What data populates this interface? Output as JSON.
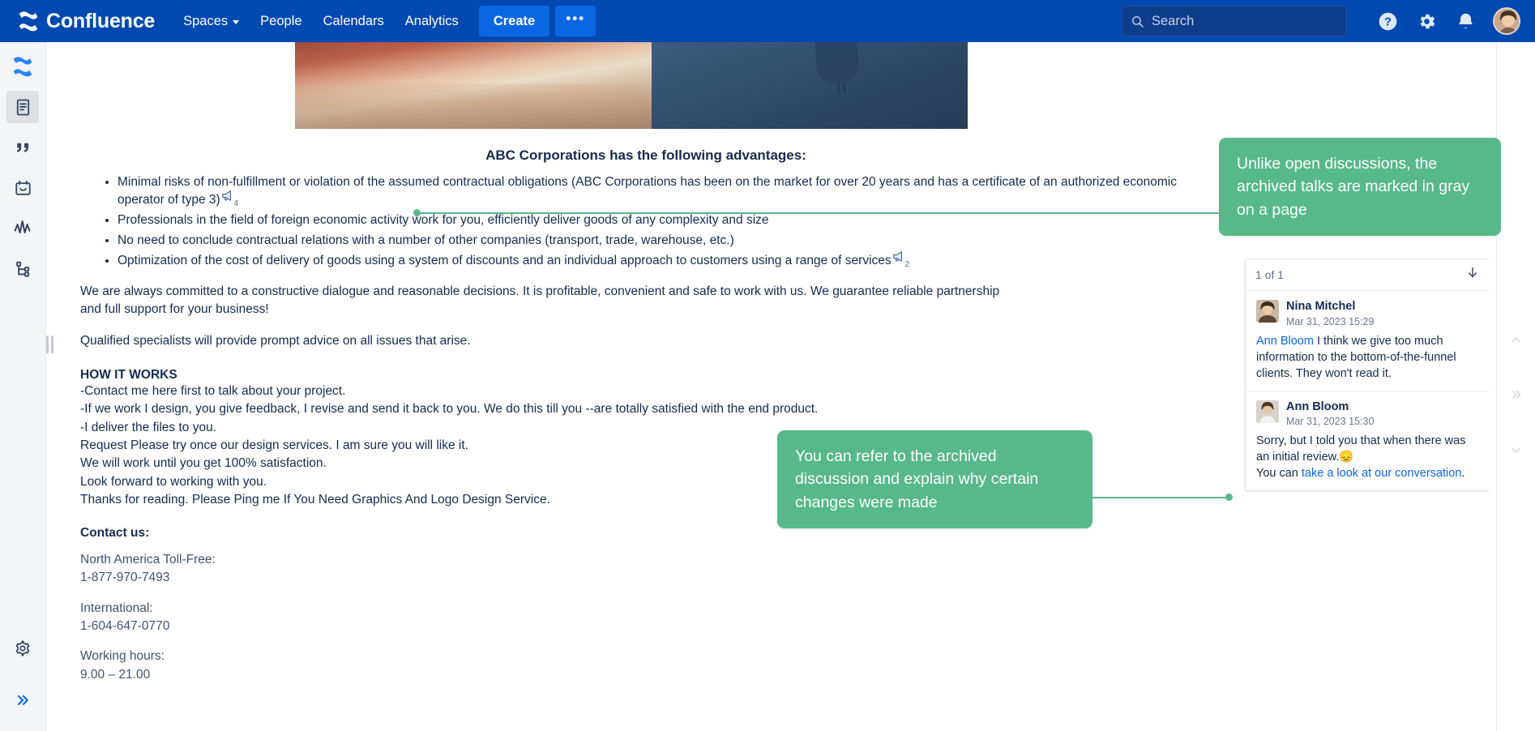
{
  "topnav": {
    "brand": "Confluence",
    "items": [
      {
        "label": "Spaces",
        "has_caret": true
      },
      {
        "label": "People",
        "has_caret": false
      },
      {
        "label": "Calendars",
        "has_caret": false
      },
      {
        "label": "Analytics",
        "has_caret": false
      }
    ],
    "create_label": "Create",
    "more_label": "•••",
    "search_placeholder": "Search",
    "icons": [
      "help-icon",
      "settings-gear-icon",
      "notifications-bell-icon",
      "user-avatar"
    ]
  },
  "sidebar": {
    "items": [
      {
        "name": "confluence-home-icon",
        "active": false
      },
      {
        "name": "page-document-icon",
        "active": true
      },
      {
        "name": "blockquote-icon",
        "active": false
      },
      {
        "name": "calendar-icon",
        "active": false
      },
      {
        "name": "analytics-icon",
        "active": false
      },
      {
        "name": "page-tree-icon",
        "active": false
      }
    ],
    "bottom_items": [
      {
        "name": "settings-gear-icon"
      },
      {
        "name": "expand-sidebar-icon"
      }
    ]
  },
  "document": {
    "heading": "ABC Corporations has the following advantages:",
    "advantages": [
      {
        "text": "Minimal risks of non-fulfillment or violation of the assumed contractual obligations (ABC Corporations has been on the market for over 20 years and has a certificate of an authorized economic operator of type 3)",
        "comment_badge": "4"
      },
      {
        "text": "Professionals in the field of foreign economic activity work for you, efficiently deliver goods of any complexity and size",
        "comment_badge": ""
      },
      {
        "text": "No need to conclude contractual relations with a number of other companies (transport, trade, warehouse, etc.)",
        "comment_badge": ""
      },
      {
        "text": "Optimization of the cost of delivery of goods using a system of discounts and an individual approach to customers using a range of services",
        "comment_badge": "2"
      }
    ],
    "paragraph_1": "We are always committed to a constructive dialogue and reasonable decisions. It is profitable, convenient and safe to work with us. We guarantee reliable partnership and full support for your business!",
    "paragraph_2": "Qualified specialists will provide prompt advice on all issues that arise.",
    "how_it_works_heading": "HOW IT WORKS",
    "how_it_works_lines": [
      "-Contact me here first to talk about your project.",
      "-If we work I design, you give feedback, I revise and send it back to you. We do this till you --are totally satisfied with the end product.",
      "-I deliver the files to you.",
      "Request Please try once our design services. I am sure you will like it.",
      "We will work until you get 100% satisfaction.",
      "Look forward to working with you.",
      "Thanks for reading. Please Ping me If You Need Graphics And Logo Design Service."
    ],
    "contact_heading": "Contact us:",
    "contact_lines": [
      "North America Toll-Free:",
      "1-877-970-7493",
      "International:",
      "1-604-647-0770",
      "Working hours:",
      "9.00 – 21.00"
    ]
  },
  "comments_panel": {
    "counter": "1 of 1",
    "jump_icon": "arrow-down-icon",
    "comments": [
      {
        "author": "Nina Mitchel",
        "timestamp": "Mar 31, 2023 15:29",
        "mention": "Ann Bloom",
        "body_after_mention": " I think we give too much information to the bottom-of-the-funnel clients. They won't read it.",
        "body_before_link": "",
        "link_text": "",
        "body_after_link": ""
      },
      {
        "author": "Ann Bloom",
        "timestamp": "Mar 31, 2023 15:30",
        "mention": "",
        "body_after_mention": "Sorry, but I told you that when there was an initial review.😞",
        "body_before_link": "You can ",
        "link_text": "take a look at our conversation",
        "body_after_link": "."
      }
    ]
  },
  "right_rail": {
    "icons": [
      "chevron-up-icon",
      "chevron-double-right-icon",
      "chevron-down-icon"
    ]
  },
  "callouts": [
    {
      "id": "callout-archived-gray",
      "text": "Unlike open discussions, the archived talks are marked in  gray on a page"
    },
    {
      "id": "callout-refer-archived",
      "text": "You can refer to the archived discussion  and explain why certain changes were made"
    }
  ],
  "colors": {
    "nav_blue": "#0049B0",
    "create_blue": "#0B66E4",
    "callout_green": "#57B88A",
    "link_blue": "#0B66E4",
    "text_primary": "#172B4D",
    "text_muted": "#6B778C"
  }
}
